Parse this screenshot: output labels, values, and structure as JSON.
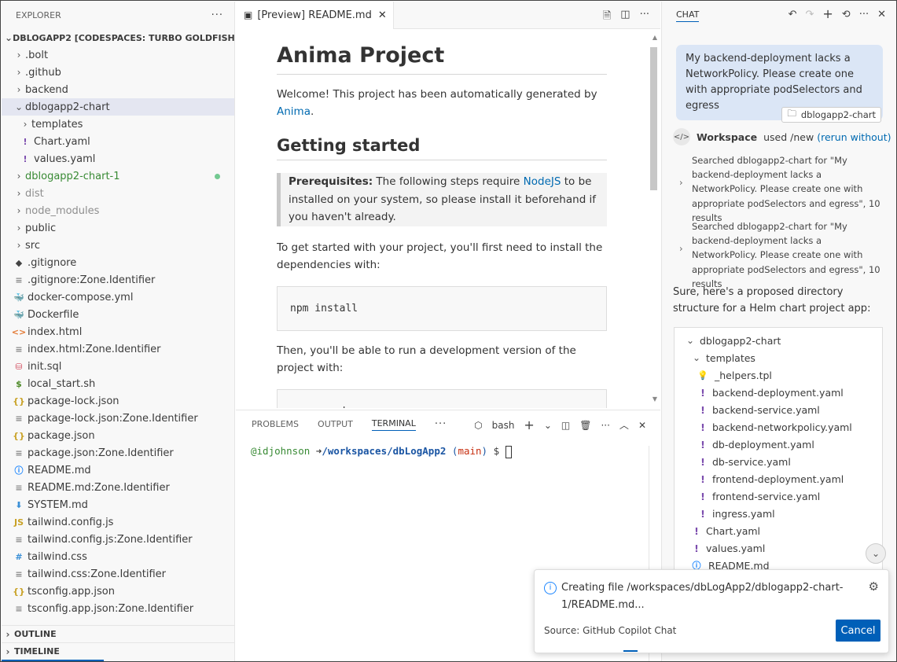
{
  "explorer": {
    "title": "EXPLORER",
    "root_label": "DBLOGAPP2 [CODESPACES: TURBO GOLDFISH]",
    "items": [
      {
        "label": ".bolt",
        "kind": "folder",
        "depth": 0
      },
      {
        "label": ".github",
        "kind": "folder",
        "depth": 0
      },
      {
        "label": "backend",
        "kind": "folder",
        "depth": 0
      },
      {
        "label": "dblogapp2-chart",
        "kind": "folder-open",
        "depth": 0,
        "selected": true
      },
      {
        "label": "templates",
        "kind": "folder",
        "depth": 1
      },
      {
        "label": "Chart.yaml",
        "kind": "yaml",
        "depth": 1
      },
      {
        "label": "values.yaml",
        "kind": "yaml",
        "depth": 1
      },
      {
        "label": "dblogapp2-chart-1",
        "kind": "folder",
        "depth": 0,
        "style": "green",
        "dot": true
      },
      {
        "label": "dist",
        "kind": "folder",
        "depth": 0,
        "style": "gray"
      },
      {
        "label": "node_modules",
        "kind": "folder",
        "depth": 0,
        "style": "gray"
      },
      {
        "label": "public",
        "kind": "folder",
        "depth": 0
      },
      {
        "label": "src",
        "kind": "folder",
        "depth": 0
      },
      {
        "label": ".gitignore",
        "kind": "git",
        "depth": 0
      },
      {
        "label": ".gitignore:Zone.Identifier",
        "kind": "text",
        "depth": 0
      },
      {
        "label": "docker-compose.yml",
        "kind": "docker",
        "depth": 0
      },
      {
        "label": "Dockerfile",
        "kind": "docker",
        "depth": 0
      },
      {
        "label": "index.html",
        "kind": "html",
        "depth": 0
      },
      {
        "label": "index.html:Zone.Identifier",
        "kind": "text",
        "depth": 0
      },
      {
        "label": "init.sql",
        "kind": "sql",
        "depth": 0
      },
      {
        "label": "local_start.sh",
        "kind": "shell",
        "depth": 0
      },
      {
        "label": "package-lock.json",
        "kind": "json",
        "depth": 0
      },
      {
        "label": "package-lock.json:Zone.Identifier",
        "kind": "text",
        "depth": 0
      },
      {
        "label": "package.json",
        "kind": "json",
        "depth": 0
      },
      {
        "label": "package.json:Zone.Identifier",
        "kind": "text",
        "depth": 0
      },
      {
        "label": "README.md",
        "kind": "info",
        "depth": 0
      },
      {
        "label": "README.md:Zone.Identifier",
        "kind": "text",
        "depth": 0
      },
      {
        "label": "SYSTEM.md",
        "kind": "markdown",
        "depth": 0
      },
      {
        "label": "tailwind.config.js",
        "kind": "js",
        "depth": 0
      },
      {
        "label": "tailwind.config.js:Zone.Identifier",
        "kind": "text",
        "depth": 0
      },
      {
        "label": "tailwind.css",
        "kind": "css",
        "depth": 0
      },
      {
        "label": "tailwind.css:Zone.Identifier",
        "kind": "text",
        "depth": 0
      },
      {
        "label": "tsconfig.app.json",
        "kind": "json",
        "depth": 0
      },
      {
        "label": "tsconfig.app.json:Zone.Identifier",
        "kind": "text",
        "depth": 0
      }
    ],
    "outline_label": "OUTLINE",
    "timeline_label": "TIMELINE"
  },
  "editor": {
    "tab_label": "[Preview] README.md",
    "h1": "Anima Project",
    "welcome_prefix": "Welcome! This project has been automatically generated by ",
    "welcome_link": "Anima",
    "welcome_suffix": ".",
    "h2": "Getting started",
    "prereq_bold": "Prerequisites:",
    "prereq_text1": " The following steps require ",
    "prereq_link": "NodeJS",
    "prereq_text2": " to be installed on your system, so please install it beforehand if you haven't already.",
    "install_text": "To get started with your project, you'll first need to install the dependencies with:",
    "code1": "npm install",
    "dev_text": "Then, you'll be able to run a development version of the project with:",
    "code2": "npm run dev"
  },
  "panel": {
    "tabs": [
      "PROBLEMS",
      "OUTPUT",
      "TERMINAL"
    ],
    "active_tab": "TERMINAL",
    "shell_label": "bash",
    "prompt_user": "@idjohnson",
    "prompt_arrow": "➜",
    "prompt_path": "/workspaces/dbLogApp2",
    "prompt_branch_open": "(",
    "prompt_branch": "main",
    "prompt_branch_close": ")",
    "prompt_dollar": "$"
  },
  "chat": {
    "tab_label": "CHAT",
    "user_message": "My backend-deployment lacks a NetworkPolicy. Please create one with appropriate podSelectors and egress",
    "attachment": "dblogapp2-chart",
    "agent_name": "Workspace",
    "agent_used": "used /new",
    "rerun_link": "(rerun without)",
    "search_results": [
      "Searched dblogapp2-chart for \"My backend-deployment lacks a NetworkPolicy. Please create one with appropriate podSelectors and egress\", 10 results",
      "Searched dblogapp2-chart for \"My backend-deployment lacks a NetworkPolicy. Please create one with appropriate podSelectors and egress\", 10 results"
    ],
    "answer": "Sure, here's a proposed directory structure for a Helm chart project app:",
    "tree": [
      {
        "label": "dblogapp2-chart",
        "kind": "folder-open",
        "depth": 0
      },
      {
        "label": "templates",
        "kind": "folder-open",
        "depth": 1
      },
      {
        "label": "_helpers.tpl",
        "kind": "bulb",
        "depth": 2
      },
      {
        "label": "backend-deployment.yaml",
        "kind": "yaml",
        "depth": 2
      },
      {
        "label": "backend-service.yaml",
        "kind": "yaml",
        "depth": 2
      },
      {
        "label": "backend-networkpolicy.yaml",
        "kind": "yaml",
        "depth": 2
      },
      {
        "label": "db-deployment.yaml",
        "kind": "yaml",
        "depth": 2
      },
      {
        "label": "db-service.yaml",
        "kind": "yaml",
        "depth": 2
      },
      {
        "label": "frontend-deployment.yaml",
        "kind": "yaml",
        "depth": 2
      },
      {
        "label": "frontend-service.yaml",
        "kind": "yaml",
        "depth": 2
      },
      {
        "label": "ingress.yaml",
        "kind": "yaml",
        "depth": 2
      },
      {
        "label": "Chart.yaml",
        "kind": "yaml",
        "depth": 1
      },
      {
        "label": "values.yaml",
        "kind": "yaml",
        "depth": 1
      },
      {
        "label": "README.md",
        "kind": "info",
        "depth": 1
      }
    ]
  },
  "notification": {
    "message": "Creating file /workspaces/dbLogApp2/dblogapp2-chart-1/README.md...",
    "source": "Source: GitHub Copilot Chat",
    "cancel_label": "Cancel"
  },
  "colors": {
    "accent": "#005fb8",
    "selection": "#e4e6f1",
    "git_added": "#388a34",
    "yaml_icon": "#7c4dae",
    "terminal_user": "#388a34",
    "terminal_path": "#1a55a3",
    "terminal_branch": "#c72e0f"
  }
}
